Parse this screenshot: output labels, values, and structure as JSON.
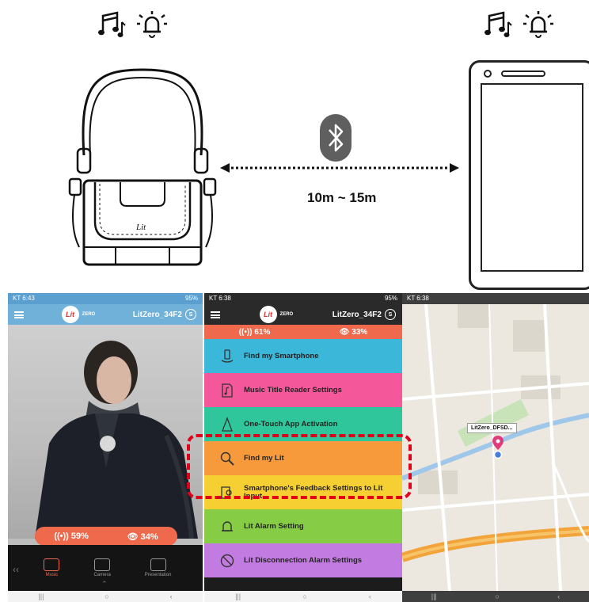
{
  "diagram": {
    "distance": "10m ~ 15m",
    "icons": [
      "music-note-icon",
      "alarm-bell-icon",
      "bluetooth-icon"
    ]
  },
  "shot1": {
    "status_left": "KT 6:43",
    "status_right": "95%",
    "logo": "Lit",
    "logo_sub": "ZERO",
    "device_name": "LitZero_34F2",
    "device_badge": "S",
    "left_stat": "59%",
    "right_stat": "34%",
    "tabs": [
      {
        "label": "Music",
        "icon": "music-icon"
      },
      {
        "label": "Camera",
        "icon": "camera-icon"
      },
      {
        "label": "Presentation",
        "icon": "presentation-icon"
      }
    ],
    "colors": {
      "header": "#6fb1d9",
      "accent": "#ef6a4d"
    }
  },
  "shot2": {
    "status_left": "KT 6:38",
    "status_right": "95%",
    "logo": "Lit",
    "logo_sub": "ZERO",
    "device_name": "LitZero_34F2",
    "device_badge": "S",
    "left_stat": "61%",
    "right_stat": "33%",
    "menu": [
      {
        "label": "Find my Smartphone",
        "color": "#3bb7d9",
        "icon": "find-phone-icon"
      },
      {
        "label": "Music Title Reader Settings",
        "color": "#f4579a",
        "icon": "music-file-icon"
      },
      {
        "label": "One-Touch App Activation",
        "color": "#2ec69a",
        "icon": "touch-icon"
      },
      {
        "label": "Find my Lit",
        "color": "#f79a3c",
        "icon": "magnifier-icon"
      },
      {
        "label": "Smartphone's Feedback Settings to Lit Input",
        "color": "#f6d033",
        "icon": "feedback-icon"
      },
      {
        "label": "Lit Alarm Setting",
        "color": "#86cc45",
        "icon": "bell-icon"
      },
      {
        "label": "Lit Disconnection Alarm Settings",
        "color": "#c27be0",
        "icon": "disconnect-icon"
      }
    ]
  },
  "shot3": {
    "status_left": "KT 6:38",
    "marker_label": "LitZero_DFSD..."
  }
}
